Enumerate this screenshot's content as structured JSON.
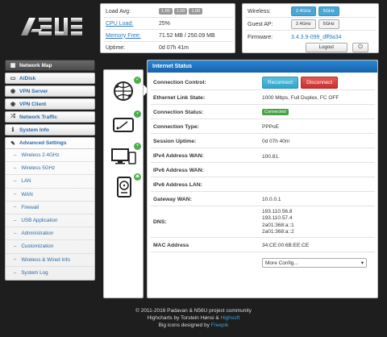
{
  "brand": {
    "logo_text": "/ISUS"
  },
  "status": {
    "load_label": "Load Avg:",
    "load_values": [
      "1.00",
      "1.00",
      "1.00"
    ],
    "cpu_label": "CPU Load:",
    "cpu_value": "25%",
    "mem_label": "Memory Free:",
    "mem_value": "71.52 MB / 250.09 MB",
    "uptime_label": "Uptime:",
    "uptime_value": "0d 07h 41m"
  },
  "wireless": {
    "wireless_label": "Wireless:",
    "guest_label": "Guest AP:",
    "band_24": "2.4GHz",
    "band_5": "5GHz",
    "firmware_label": "Firmware:",
    "firmware_value": "3.4.3.9-099_dff9a34",
    "logout_label": "Logout",
    "power_glyph": "⏻"
  },
  "sidebar": {
    "items": [
      {
        "label": "Network Map",
        "icon": "grid-icon",
        "glyph": "▦"
      },
      {
        "label": "AiDisk",
        "icon": "hdd-icon",
        "glyph": "▭"
      },
      {
        "label": "VPN Server",
        "icon": "globe-icon",
        "glyph": "◉"
      },
      {
        "label": "VPN Client",
        "icon": "globe-icon",
        "glyph": "◉"
      },
      {
        "label": "Network Traffic",
        "icon": "shuffle-icon",
        "glyph": "⤮"
      },
      {
        "label": "System Info",
        "icon": "info-icon",
        "glyph": "ℹ"
      },
      {
        "label": "Advanced Settings",
        "icon": "wrench-icon",
        "glyph": "✎"
      }
    ],
    "subitems": [
      "Wireless 2.4GHz",
      "Wireless 5GHz",
      "LAN",
      "WAN",
      "Firewall",
      "USB Application",
      "Administration",
      "Customization",
      "Wireless & Wired Info",
      "System Log"
    ]
  },
  "main": {
    "title": "Internet Status",
    "rows": {
      "conn_control": "Connection Control:",
      "reconnect": "Reconnect",
      "disconnect": "Disconnect",
      "eth_label": "Ethernet Link State:",
      "eth_value": "1000 Mbps, Full Duplex, FC OFF",
      "conn_status_label": "Connection Status:",
      "conn_status_value": "Connected",
      "conn_type_label": "Connection Type:",
      "conn_type_value": "PPPoE",
      "session_label": "Session Uptime:",
      "session_value": "0d 07h 40m",
      "ipv4_label": "IPv4 Address WAN:",
      "ipv4_value": "100.81.",
      "ipv6wan_label": "IPv6 Address WAN:",
      "ipv6lan_label": "IPv6 Address LAN:",
      "gateway_label": "Gateway WAN:",
      "gateway_value": "10.0.0.1",
      "dns_label": "DNS:",
      "dns_values": [
        "193.110.56.8",
        "193.110.57.4",
        "2a01:368:a::1",
        "2a01:368:a::2"
      ],
      "mac_label": "MAC Address",
      "mac_value": "34:CE:00:6B:EE:CE",
      "more_config": "More Config..."
    }
  },
  "footer": {
    "line1": "© 2011-2016 Padavan & N56U project community",
    "line2_prefix": "Highcharts by Torstein Hønsi & ",
    "line2_link": "Highsoft",
    "line3_prefix": "Big icons designed by ",
    "line3_link": "Freepik"
  }
}
